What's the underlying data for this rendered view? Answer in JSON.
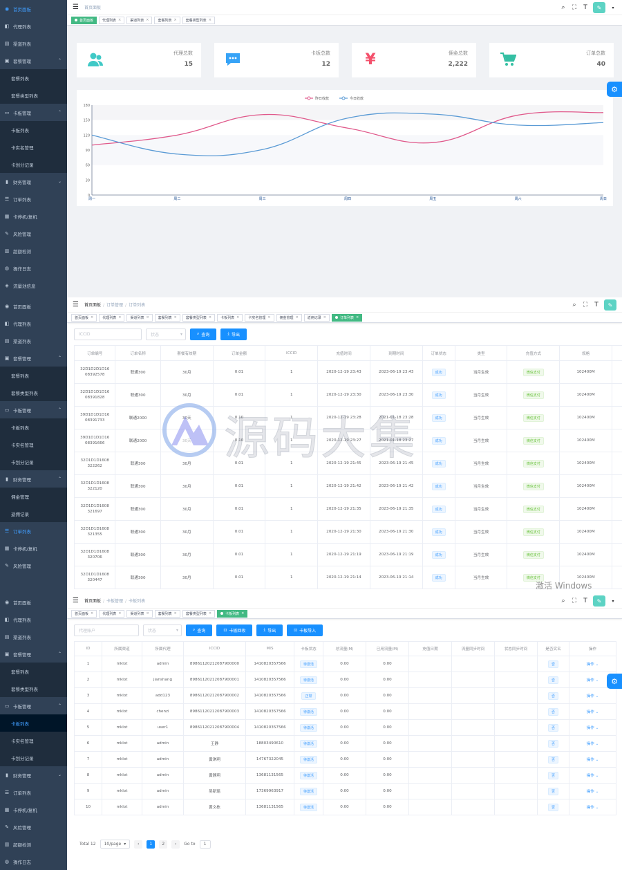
{
  "colors": {
    "sidebar": "#304156",
    "accent": "#1890ff",
    "tag_active": "#42b983",
    "series_prev": "#e0598b",
    "series_today": "#5b9bd5"
  },
  "p1": {
    "sidebar": [
      {
        "icon": "dashboard-icon",
        "label": "首页面板",
        "active": true
      },
      {
        "icon": "agent-icon",
        "label": "代理列表"
      },
      {
        "icon": "channel-icon",
        "label": "渠道列表"
      },
      {
        "icon": "package-icon",
        "label": "套餐管理",
        "arrow": "^"
      },
      {
        "label": "套餐列表",
        "sub": true
      },
      {
        "label": "套餐类型列表",
        "sub": true
      },
      {
        "icon": "card-icon",
        "label": "卡板管理",
        "arrow": "^"
      },
      {
        "label": "卡板列表",
        "sub": true
      },
      {
        "label": "卡实名管理",
        "sub": true
      },
      {
        "label": "卡划分记录",
        "sub": true
      },
      {
        "icon": "finance-icon",
        "label": "财务管理",
        "arrow": "v"
      },
      {
        "icon": "order-icon",
        "label": "订单列表"
      },
      {
        "icon": "stop-icon",
        "label": "卡停机/复机"
      },
      {
        "icon": "risk-icon",
        "label": "风险管理"
      },
      {
        "icon": "test-icon",
        "label": "超额检测"
      },
      {
        "icon": "log-icon",
        "label": "操作日志"
      },
      {
        "icon": "flow-icon",
        "label": "流量池信息"
      }
    ],
    "breadcrumb": [
      "首页面板"
    ],
    "tags": [
      {
        "label": "首页面板",
        "on": true
      },
      {
        "label": "代理列表"
      },
      {
        "label": "渠道列表"
      },
      {
        "label": "套餐列表"
      },
      {
        "label": "套餐类型列表"
      }
    ],
    "cards": [
      {
        "icon": "people-icon",
        "label": "代理总数",
        "value": "15",
        "color": "#40c9c6"
      },
      {
        "icon": "message-icon",
        "label": "卡板总数",
        "value": "12",
        "color": "#36a3f7"
      },
      {
        "icon": "money-icon",
        "label": "佣金总数",
        "value": "2,222",
        "color": "#f4516c"
      },
      {
        "icon": "shopping-icon",
        "label": "订单总数",
        "value": "40",
        "color": "#34bfa3"
      }
    ]
  },
  "chart_data": {
    "type": "line",
    "categories": [
      "周一",
      "周二",
      "周三",
      "周四",
      "周五",
      "周六",
      "周日"
    ],
    "series": [
      {
        "name": "昨日收款",
        "values": [
          100,
          120,
          161,
          134,
          105,
          160,
          165
        ]
      },
      {
        "name": "今日收款",
        "values": [
          120,
          82,
          91,
          154,
          162,
          140,
          145
        ]
      }
    ],
    "yticks": [
      "0",
      "30",
      "60",
      "90",
      "120",
      "150",
      "180"
    ],
    "ylim": [
      0,
      180
    ],
    "legend": "top-center",
    "grid": false
  },
  "p2": {
    "sidebar": [
      {
        "icon": "dashboard-icon",
        "label": "首页面板"
      },
      {
        "icon": "agent-icon",
        "label": "代理列表"
      },
      {
        "icon": "channel-icon",
        "label": "渠道列表"
      },
      {
        "icon": "package-icon",
        "label": "套餐管理",
        "arrow": "^"
      },
      {
        "label": "套餐列表",
        "sub": true
      },
      {
        "label": "套餐类型列表",
        "sub": true
      },
      {
        "icon": "card-icon",
        "label": "卡板管理",
        "arrow": "^"
      },
      {
        "label": "卡板列表",
        "sub": true
      },
      {
        "label": "卡实名管理",
        "sub": true
      },
      {
        "label": "卡划分记录",
        "sub": true
      },
      {
        "icon": "finance-icon",
        "label": "财务管理",
        "arrow": "^"
      },
      {
        "label": "佣金管理",
        "sub": true
      },
      {
        "label": "返佣记录",
        "sub": true
      },
      {
        "icon": "order-icon",
        "label": "订单列表",
        "active": true
      },
      {
        "icon": "stop-icon",
        "label": "卡停机/复机"
      },
      {
        "icon": "risk-icon",
        "label": "风险管理"
      }
    ],
    "breadcrumb": [
      "首页面板",
      "订单管理",
      "订单列表"
    ],
    "tags": [
      {
        "label": "首页面板"
      },
      {
        "label": "代理列表"
      },
      {
        "label": "渠道列表"
      },
      {
        "label": "套餐列表"
      },
      {
        "label": "套餐类型列表"
      },
      {
        "label": "卡板列表"
      },
      {
        "label": "卡实名管理"
      },
      {
        "label": "佣金管理"
      },
      {
        "label": "返佣记录"
      },
      {
        "label": "订单列表",
        "on": true
      }
    ],
    "filter": {
      "iccid_placeholder": "ICCID",
      "status_placeholder": "状态",
      "search": "查询",
      "export": "导出"
    },
    "columns": [
      "订单编号",
      "订单名称",
      "套餐有效期",
      "订单金额",
      "ICCID",
      "充值时间",
      "到期时间",
      "订单状态",
      "类型",
      "充值方式",
      "规格",
      "所属"
    ],
    "rows": [
      [
        "32D1D2D1D16 08392578",
        "联通300",
        "30月",
        "0.01",
        "1",
        "2020-12-19 23:43",
        "2023-06-19 23:43",
        "成功",
        "当月生效",
        "微信支付",
        "102400M",
        "ad"
      ],
      [
        "32D1D1D1D16 08391828",
        "联通300",
        "30月",
        "0.01",
        "1",
        "2020-12-19 23:30",
        "2023-06-19 23:30",
        "成功",
        "当月生效",
        "微信支付",
        "102400M",
        "ad"
      ],
      [
        "39D1D1D1D16 08391733",
        "联通2000",
        "30天",
        "0.10",
        "1",
        "2020-12-19 23:28",
        "2021-01-18 23:28",
        "成功",
        "当月生效",
        "微信支付",
        "102400M",
        "ad"
      ],
      [
        "39D1D1D1D16 08391666",
        "联通2000",
        "30天",
        "0.10",
        "1",
        "2020-12-19 23:27",
        "2021-01-18 23:27",
        "成功",
        "当月生效",
        "微信支付",
        "102400M",
        "ad"
      ],
      [
        "32D1D1D1608 322262",
        "联通300",
        "30月",
        "0.01",
        "1",
        "2020-12-19 21:45",
        "2023-06-19 21:45",
        "成功",
        "当月生效",
        "微信支付",
        "102400M",
        "ad"
      ],
      [
        "32D1D1D1608 322120",
        "联通300",
        "30月",
        "0.01",
        "1",
        "2020-12-19 21:42",
        "2023-06-19 21:42",
        "成功",
        "当月生效",
        "微信支付",
        "102400M",
        "ad"
      ],
      [
        "32D1D1D1608 321697",
        "联通300",
        "30月",
        "0.01",
        "1",
        "2020-12-19 21:35",
        "2023-06-19 21:35",
        "成功",
        "当月生效",
        "微信支付",
        "102400M",
        "ad"
      ],
      [
        "32D1D1D1608 321355",
        "联通300",
        "30月",
        "0.01",
        "1",
        "2020-12-19 21:30",
        "2023-06-19 21:30",
        "成功",
        "当月生效",
        "微信支付",
        "102400M",
        "ad"
      ],
      [
        "32D1D1D1608 320706",
        "联通300",
        "30月",
        "0.01",
        "1",
        "2020-12-19 21:19",
        "2023-06-19 21:19",
        "成功",
        "当月生效",
        "微信支付",
        "102400M",
        "ad"
      ],
      [
        "32D1D1D1608 320447",
        "联通300",
        "30月",
        "0.01",
        "1",
        "2020-12-19 21:14",
        "2023-06-19 21:14",
        "成功",
        "当月生效",
        "微信支付",
        "102400M",
        "ad"
      ]
    ]
  },
  "p3": {
    "sidebar": [
      {
        "icon": "dashboard-icon",
        "label": "首页面板"
      },
      {
        "icon": "agent-icon",
        "label": "代理列表"
      },
      {
        "icon": "channel-icon",
        "label": "渠道列表"
      },
      {
        "icon": "package-icon",
        "label": "套餐管理",
        "arrow": "^"
      },
      {
        "label": "套餐列表",
        "sub": true
      },
      {
        "label": "套餐类型列表",
        "sub": true
      },
      {
        "icon": "card-icon",
        "label": "卡板管理",
        "arrow": "^"
      },
      {
        "label": "卡板列表",
        "sub": true,
        "active": true
      },
      {
        "label": "卡实名管理",
        "sub": true
      },
      {
        "label": "卡划分记录",
        "sub": true
      },
      {
        "icon": "finance-icon",
        "label": "财务管理",
        "arrow": "v"
      },
      {
        "icon": "order-icon",
        "label": "订单列表"
      },
      {
        "icon": "stop-icon",
        "label": "卡停机/复机"
      },
      {
        "icon": "risk-icon",
        "label": "风险管理"
      },
      {
        "icon": "test-icon",
        "label": "超额检测"
      },
      {
        "icon": "log-icon",
        "label": "操作日志"
      }
    ],
    "breadcrumb": [
      "首页面板",
      "卡板管理",
      "卡板列表"
    ],
    "tags": [
      {
        "label": "首页面板"
      },
      {
        "label": "代理列表"
      },
      {
        "label": "渠道列表"
      },
      {
        "label": "套餐列表"
      },
      {
        "label": "套餐类型列表"
      },
      {
        "label": "卡板列表",
        "on": true
      }
    ],
    "filter": {
      "agent_placeholder": "代理账户",
      "status_placeholder": "状态",
      "search": "查询",
      "recycle": "卡板回收",
      "export": "导出",
      "import": "卡板导入"
    },
    "columns": [
      "ID",
      "所属渠道",
      "所属代理",
      "ICCID",
      "MIS",
      "卡板状态",
      "总流量(M)",
      "已用流量(M)",
      "充值日期",
      "流量同步时间",
      "状态同步时间",
      "是否实名",
      "操作"
    ],
    "rows": [
      [
        "1",
        "mklot",
        "admin",
        "89861120212087900000",
        "1410820357566",
        "待激活",
        "0.00",
        "0.00",
        "",
        "",
        "",
        "否",
        "操作"
      ],
      [
        "2",
        "mklot",
        "jianshang",
        "89861120212087900001",
        "1410820357566",
        "待激活",
        "0.00",
        "0.00",
        "",
        "",
        "",
        "否",
        "操作"
      ],
      [
        "3",
        "mklot",
        "add123",
        "89861120212087900002",
        "1410820357566",
        "正常",
        "0.00",
        "0.00",
        "",
        "",
        "",
        "否",
        "操作"
      ],
      [
        "4",
        "mklot",
        "chenzi",
        "89861120212087900003",
        "1410820357566",
        "待激活",
        "0.00",
        "0.00",
        "",
        "",
        "",
        "否",
        "操作"
      ],
      [
        "5",
        "mklot",
        "user1",
        "89861120212087900004",
        "1410820357566",
        "待激活",
        "0.00",
        "0.00",
        "",
        "",
        "",
        "否",
        "操作"
      ],
      [
        "6",
        "mklot",
        "admin",
        "王静",
        "18803490610",
        "待激活",
        "0.00",
        "0.00",
        "",
        "",
        "",
        "否",
        "操作"
      ],
      [
        "7",
        "mklot",
        "admin",
        "黄琪玥",
        "14767322045",
        "待激活",
        "0.00",
        "0.00",
        "",
        "",
        "",
        "否",
        "操作"
      ],
      [
        "8",
        "mklot",
        "admin",
        "黄静玥",
        "13681131565",
        "待激活",
        "0.00",
        "0.00",
        "",
        "",
        "",
        "否",
        "操作"
      ],
      [
        "9",
        "mklot",
        "admin",
        "吴新瑶",
        "17369963917",
        "待激活",
        "0.00",
        "0.00",
        "",
        "",
        "",
        "否",
        "操作"
      ],
      [
        "10",
        "mklot",
        "admin",
        "黄文栋",
        "13681131565",
        "待激活",
        "0.00",
        "0.00",
        "",
        "",
        "",
        "否",
        "操作"
      ]
    ],
    "pager": {
      "total": "Total 12",
      "size": "10/page",
      "pages": [
        "1",
        "2"
      ],
      "goto": "Go to",
      "goto_val": "1"
    }
  },
  "watermark": "源码大集",
  "activation": "激活 Windows"
}
